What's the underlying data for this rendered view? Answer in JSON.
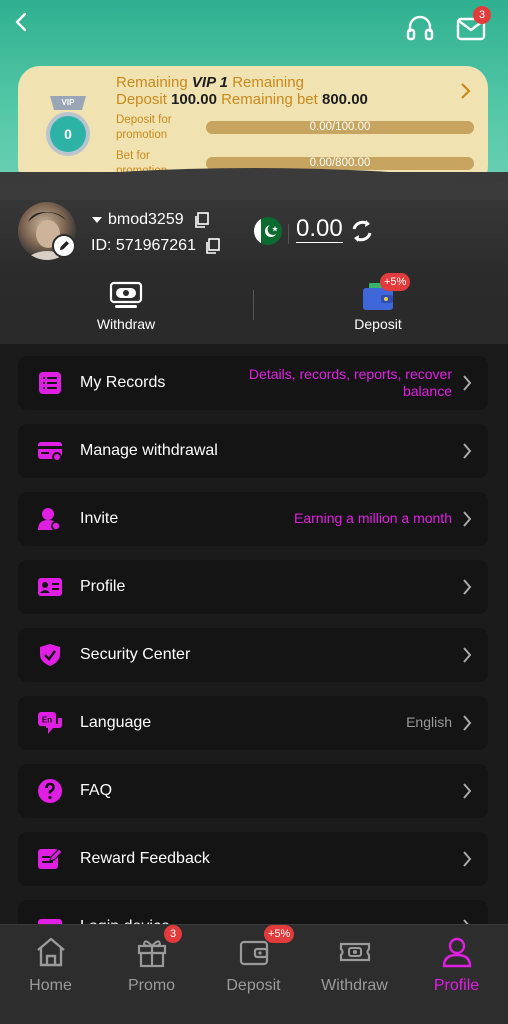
{
  "header": {
    "mail_badge": "3",
    "icons": [
      "back-icon",
      "headset-icon",
      "mail-icon"
    ]
  },
  "vip": {
    "remaining_prefix": "Remaining",
    "level": "VIP 1",
    "remaining_suffix": "Remaining",
    "deposit_label": "Deposit",
    "deposit_value": "100.00",
    "bet_label": "Remaining bet",
    "bet_value": "800.00",
    "medal_value": "0",
    "medal_tag": "VIP",
    "deposit_promo_label": "Deposit for promotion",
    "deposit_progress": "0.00/100.00",
    "bet_promo_label": "Bet for promotion",
    "bet_progress": "0.00/800.00",
    "deposit_fill": 0,
    "bet_fill": 0
  },
  "user": {
    "name": "bmod3259",
    "id": "ID: 571967261",
    "balance": "0.00"
  },
  "quick_actions": {
    "withdraw_label": "Withdraw",
    "deposit_label": "Deposit",
    "deposit_badge": "+5%"
  },
  "menu": [
    {
      "label": "My Records",
      "sub": "Details, records, reports, recover balance"
    },
    {
      "label": "Manage withdrawal",
      "sub": ""
    },
    {
      "label": "Invite",
      "sub": "Earning a million a month"
    },
    {
      "label": "Profile",
      "sub": ""
    },
    {
      "label": "Security Center",
      "sub": ""
    },
    {
      "label": "Language",
      "sub": "English"
    },
    {
      "label": "FAQ",
      "sub": ""
    },
    {
      "label": "Reward Feedback",
      "sub": ""
    },
    {
      "label": "Login device",
      "sub": ""
    }
  ],
  "nav": {
    "home": "Home",
    "promo": "Promo",
    "promo_badge": "3",
    "deposit": "Deposit",
    "deposit_badge": "+5%",
    "withdraw": "Withdraw",
    "profile": "Profile",
    "active": "Profile"
  },
  "colors": {
    "accent": "#e11ee3",
    "header_green": "#52c7a6",
    "vip_card": "#f1e2b2",
    "gold_text": "#c98a1c",
    "badge_red": "#e23b3b"
  }
}
